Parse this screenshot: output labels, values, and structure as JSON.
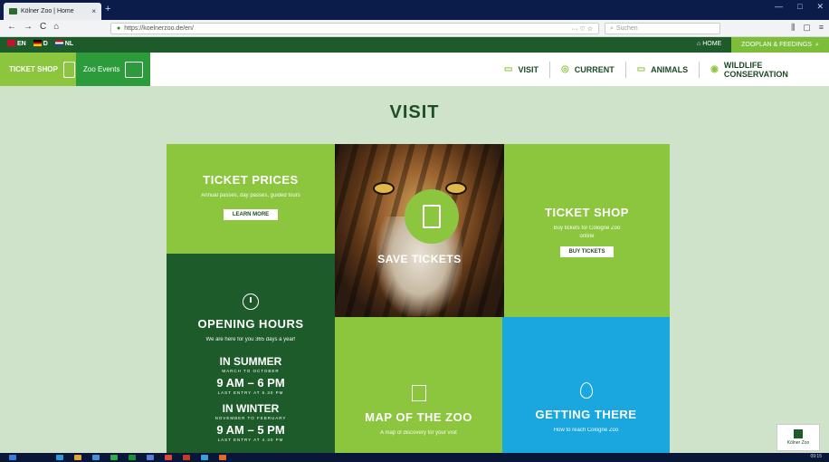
{
  "browser": {
    "tab_title": "Kölner Zoo | Home",
    "tab_close": "×",
    "new_tab": "+",
    "nav": {
      "back": "←",
      "forward": "→",
      "reload": "C",
      "home": "⌂"
    },
    "url": "https://koelnerzoo.de/en/",
    "url_tools": "··· ♡ ☆",
    "search_placeholder": "Suchen",
    "window_controls": {
      "minimize": "—",
      "maximize": "□",
      "close": "✕"
    },
    "right_controls": [
      "⫼",
      "▢",
      "≡"
    ]
  },
  "site_bar": {
    "languages": [
      {
        "code": "EN",
        "color": "#c8102e"
      },
      {
        "code": "D",
        "color": "#ffcc00"
      },
      {
        "code": "NL",
        "color": "#ae1c28"
      }
    ],
    "home_label": "HOME",
    "feeding_label": "ZOOPLAN & FEEDINGS"
  },
  "main_nav": {
    "ticket_shop": "TICKET SHOP",
    "zoo_events": "Zoo Events",
    "items": [
      {
        "label": "VISIT",
        "icon": "ticket-icon"
      },
      {
        "label": "CURRENT",
        "icon": "target-icon"
      },
      {
        "label": "ANIMALS",
        "icon": "animal-icon"
      },
      {
        "label": "WILDLIFE CONSERVATION",
        "icon": "leaf-icon"
      }
    ]
  },
  "content": {
    "heading": "VISIT",
    "ticket_prices": {
      "title": "TICKET PRICES",
      "desc": "Annual passes, day passes, guided tours",
      "button": "LEARN MORE"
    },
    "save_tickets": {
      "label": "SAVE TICKETS"
    },
    "ticket_shop": {
      "title": "TICKET SHOP",
      "desc": "Buy tickets for Cologne Zoo online",
      "button": "BUY TICKETS"
    },
    "opening_hours": {
      "title": "OPENING HOURS",
      "desc": "We are here for you 365 days a year!",
      "summer": {
        "label": "IN SUMMER",
        "range": "MARCH TO OCTOBER",
        "time": "9 AM – 6 PM",
        "note": "LAST ENTRY AT 5.30 PM"
      },
      "winter": {
        "label": "IN WINTER",
        "range": "NOVEMBER TO FEBRUARY",
        "time": "9 AM – 5 PM",
        "note": "LAST ENTRY AT 4.30 PM"
      }
    },
    "map": {
      "title": "MAP OF THE ZOO",
      "desc": "A map of discovery for your visit"
    },
    "getting_there": {
      "title": "GETTING THERE",
      "desc": "How to reach Cologne Zoo"
    }
  },
  "badge": {
    "text": "Kölner Zoo"
  },
  "taskbar": {
    "time": "09:15"
  },
  "colors": {
    "dark_green": "#1d5b2a",
    "lime": "#8cc63e",
    "blue": "#1aa7df",
    "page_bg": "#cfe3cb"
  }
}
